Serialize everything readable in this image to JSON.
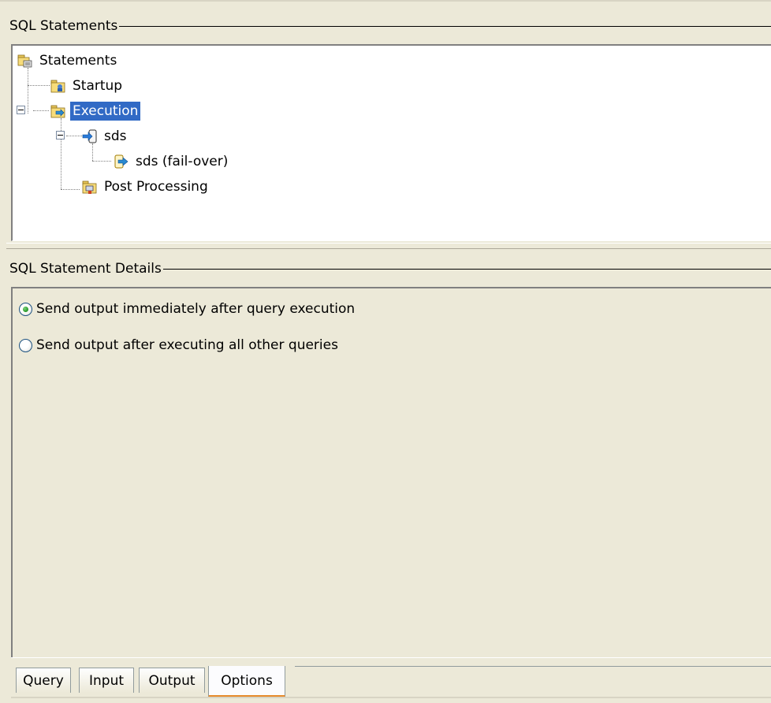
{
  "statements_group": {
    "title": "SQL Statements"
  },
  "tree": {
    "root": "Statements",
    "items": [
      {
        "label": "Startup",
        "icon": "startup-folder-icon"
      },
      {
        "label": "Execution",
        "icon": "execution-folder-icon",
        "selected": true,
        "expanded": true
      },
      {
        "label": "sds",
        "icon": "sql-statement-icon",
        "expanded": true
      },
      {
        "label": "sds (fail-over)",
        "icon": "failover-statement-icon"
      },
      {
        "label": "Post Processing",
        "icon": "post-processing-folder-icon"
      }
    ]
  },
  "details_group": {
    "title": "SQL Statement Details"
  },
  "options": {
    "radio_immediate": "Send output immediately after query execution",
    "radio_after_all": "Send output after executing all other queries",
    "selected": "immediate"
  },
  "tabs": [
    {
      "label": "Query"
    },
    {
      "label": "Input"
    },
    {
      "label": "Output"
    },
    {
      "label": "Options",
      "active": true
    }
  ],
  "colors": {
    "selection": "#316ac5",
    "active_tab_accent": "#e68b2c",
    "panel_bg": "#ece9d8"
  }
}
